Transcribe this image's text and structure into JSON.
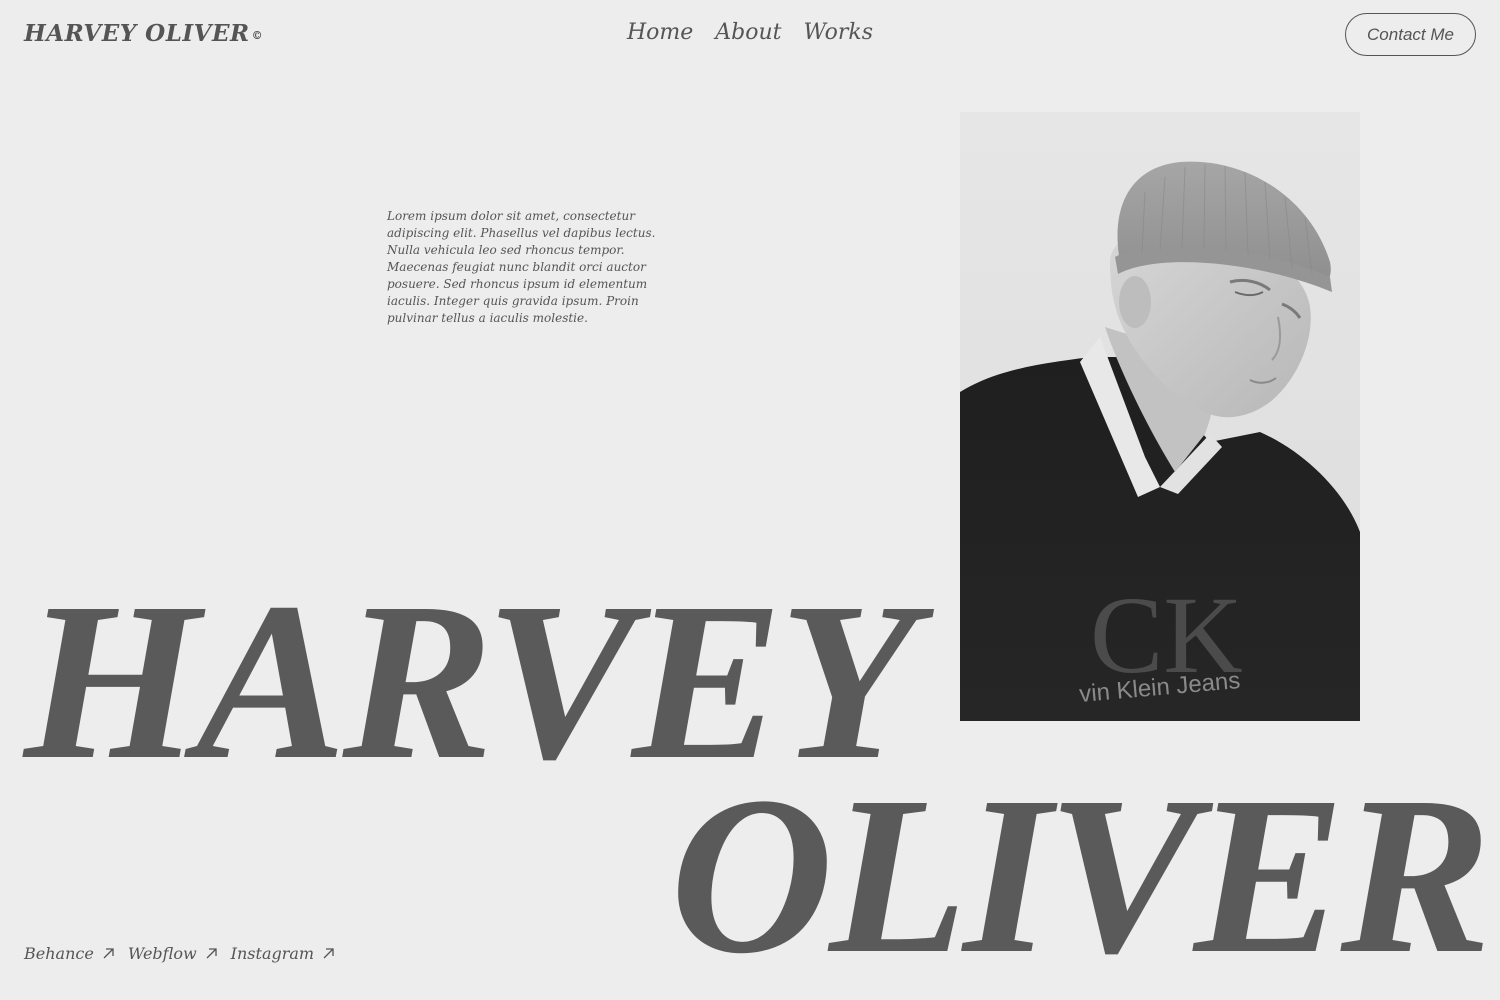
{
  "header": {
    "logo_text": "HARVEY  OLIVER",
    "logo_mark": "©",
    "nav": [
      {
        "label": "Home"
      },
      {
        "label": "About"
      },
      {
        "label": "Works"
      }
    ],
    "contact_label": "Contact Me"
  },
  "intro": {
    "text": "Lorem ipsum dolor sit amet, consectetur adipiscing elit. Phasellus vel dapibus lectus. Nulla vehicula leo sed rhoncus tempor. Maecenas feugiat nunc blandit orci auctor posuere. Sed rhoncus ipsum id elementum iaculis. Integer quis gravida ipsum. Proin pulvinar tellus a iaculis molestie."
  },
  "photo": {
    "shirt_text": "vin Klein Jeans",
    "shirt_logo": "CK"
  },
  "hero": {
    "line1": "HARVEY",
    "line2": "OLIVER"
  },
  "socials": [
    {
      "label": "Behance",
      "icon": "arrow-up-right-icon"
    },
    {
      "label": "Webflow",
      "icon": "arrow-up-right-icon"
    },
    {
      "label": "Instagram",
      "icon": "arrow-up-right-icon"
    }
  ],
  "colors": {
    "background": "#ededed",
    "text": "#555555"
  }
}
